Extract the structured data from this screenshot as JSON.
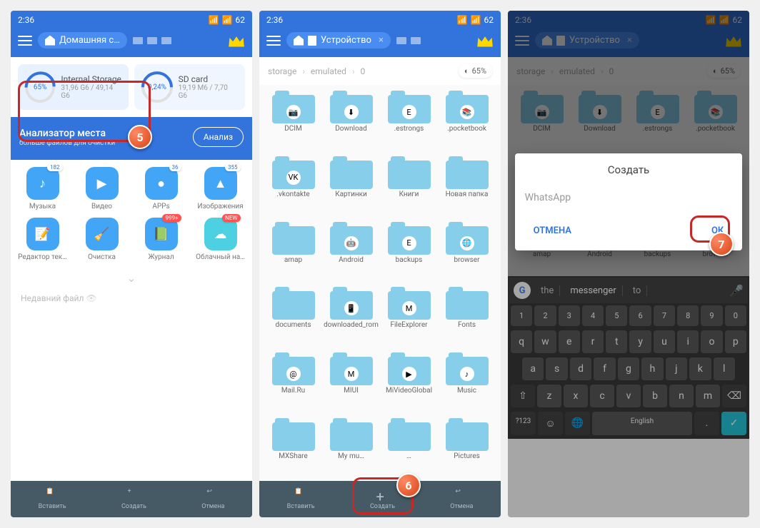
{
  "time": "2:36",
  "battery": "62",
  "p1": {
    "chip": "Домашняя с…",
    "internal": {
      "name": "Internal Storage",
      "pct": "65%",
      "size": "31,96 G6 / 49,14 G6"
    },
    "sdcard": {
      "name": "SD card",
      "pct": "0,24%",
      "size": "19,19 M6 / 7,70 G6"
    },
    "analyzer": "Анализатор места",
    "analyzer_sub": "больше файлов для очистки",
    "analyze": "Анализ",
    "grid": [
      {
        "l": "Музыка",
        "b": "182",
        "c": "#42a5f5"
      },
      {
        "l": "Видео",
        "b": "",
        "c": "#42a5f5"
      },
      {
        "l": "APPs",
        "b": "36",
        "c": "#42a5f5"
      },
      {
        "l": "Изображения",
        "b": "355",
        "c": "#42a5f5"
      },
      {
        "l": "Редактор тек…",
        "b": "",
        "c": "#42a5f5"
      },
      {
        "l": "Очистка",
        "b": "",
        "c": "#42a5f5"
      },
      {
        "l": "Журнал",
        "b": "999+",
        "c": "#42a5f5",
        "br": true
      },
      {
        "l": "Облачный на…",
        "b": "NEW",
        "c": "#4dd0e1",
        "bn": true
      }
    ],
    "recent": "Недавний файл"
  },
  "p2": {
    "chip": "Устройство",
    "bc": [
      "storage",
      "emulated",
      "0"
    ],
    "pct": "65%",
    "folders": [
      "DCIM",
      "Download",
      ".estrongs",
      ".pocketbook",
      ".vkontakte",
      "Картинки",
      "Книги",
      "Новая папка",
      "amap",
      "Android",
      "backups",
      "browser",
      "documents",
      "downloaded_rom",
      "FileExplorer",
      "Fonts",
      "Mail.Ru",
      "MIUI",
      "MiVideoGlobal",
      "Music",
      "MXShare",
      "My mu…",
      "…",
      "Pictures"
    ]
  },
  "p3": {
    "dialog_title": "Создать",
    "input": "WhatsApp",
    "cancel": "ОТМЕНА",
    "ok": "ОК",
    "sugg": [
      "the",
      "messenger",
      "to"
    ],
    "lang": "English"
  },
  "bb": {
    "paste": "Вставить",
    "create": "Создать",
    "cancel": "Отмена"
  },
  "steps": {
    "5": "5",
    "6": "6",
    "7": "7"
  }
}
